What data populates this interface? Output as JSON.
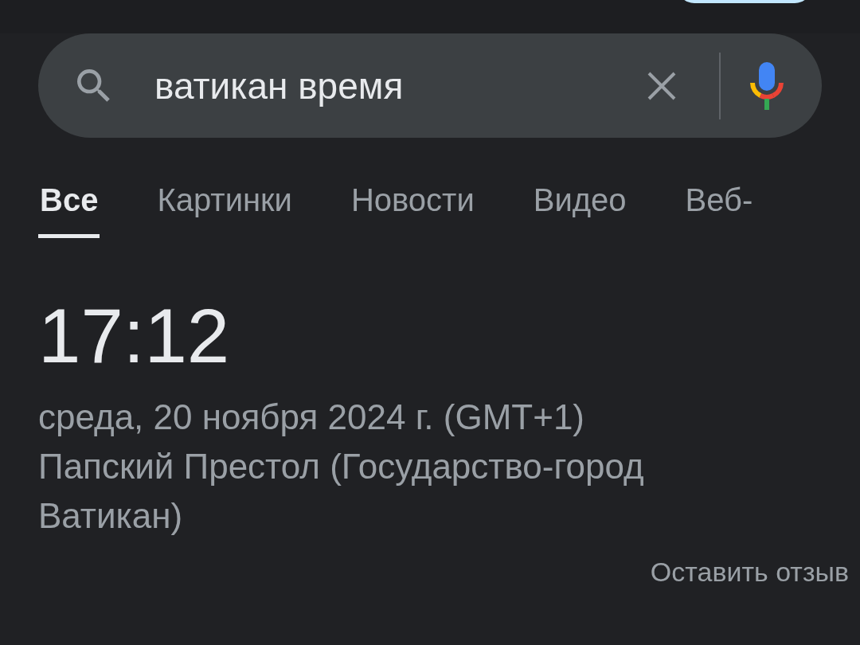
{
  "search": {
    "value": "ватикан время"
  },
  "tabs": [
    {
      "label": "Все",
      "selected": true
    },
    {
      "label": "Картинки",
      "selected": false
    },
    {
      "label": "Новости",
      "selected": false
    },
    {
      "label": "Видео",
      "selected": false
    },
    {
      "label": "Веб-",
      "selected": false
    }
  ],
  "clock": {
    "time": "17:12",
    "date": "среда, 20 ноября 2024 г. (GMT+1)",
    "location": "Папский Престол (Государство-город Ватикан)"
  },
  "feedback_link": "Оставить отзыв"
}
